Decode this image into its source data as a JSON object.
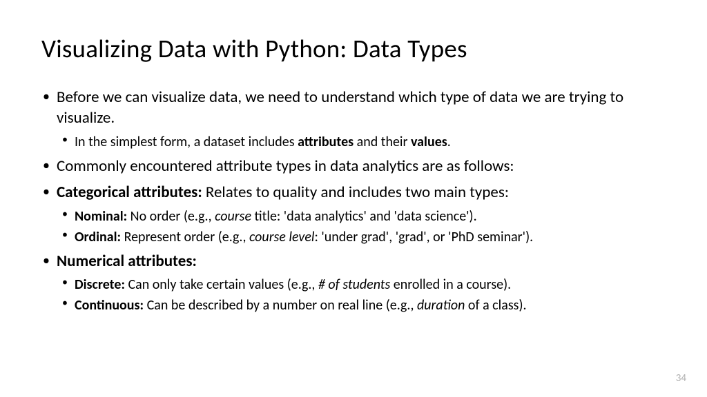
{
  "title": "Visualizing Data with Python: Data Types",
  "bullets": {
    "b1": "Before we can visualize data, we need to understand which type of data we are trying to visualize.",
    "b1_1_pre": "In the simplest form, a dataset includes ",
    "b1_1_bold1": "attributes",
    "b1_1_mid": " and their ",
    "b1_1_bold2": "values",
    "b1_1_post": ".",
    "b2": "Commonly encountered attribute types in data analytics are as follows:",
    "b3_bold": "Categorical attributes:",
    "b3_text": " Relates to quality and includes two main types:",
    "b3_1_bold": "Nominal:",
    "b3_1_pre": " No order (e.g., ",
    "b3_1_italic": "course",
    "b3_1_post": " title: 'data analytics' and 'data science').",
    "b3_2_bold": "Ordinal:",
    "b3_2_pre": " Represent order (e.g., ",
    "b3_2_italic": "course level",
    "b3_2_post": ": 'under grad', 'grad', or 'PhD seminar').",
    "b4_bold": "Numerical attributes:",
    "b4_1_bold": "Discrete:",
    "b4_1_pre": " Can only take certain values (e.g., ",
    "b4_1_italic": "# of students",
    "b4_1_post": " enrolled in a course).",
    "b4_2_bold": "Continuous:",
    "b4_2_pre": " Can be described by a number on real line (e.g., ",
    "b4_2_italic": "duration",
    "b4_2_post": " of a class)."
  },
  "pageNumber": "34"
}
